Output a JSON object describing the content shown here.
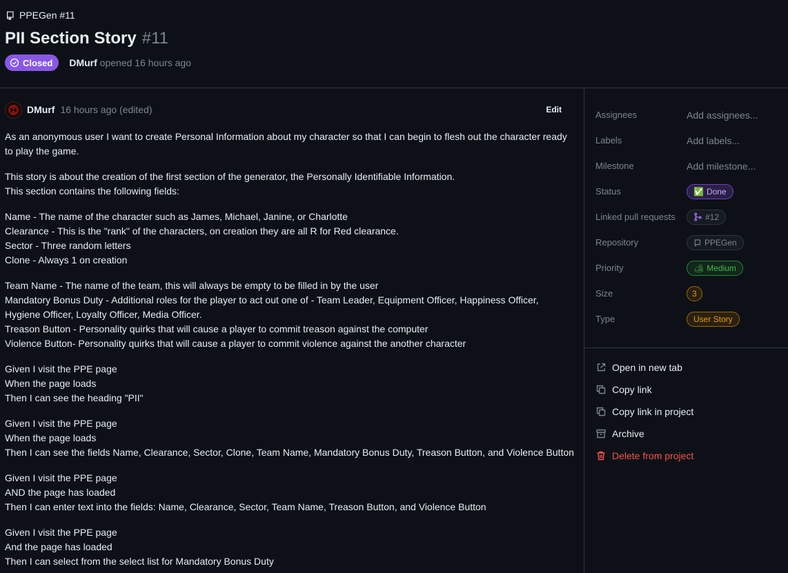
{
  "header": {
    "crumb": "PPEGen #11",
    "title": "PII Section Story",
    "number": "#11",
    "status": "Closed",
    "author": "DMurf",
    "opened_text": "opened 16 hours ago"
  },
  "comment": {
    "author": "DMurf",
    "time": "16 hours ago (edited)",
    "edit_label": "Edit",
    "paragraphs": [
      [
        "As an anonymous user I want to create Personal Information about my character so that I can begin to flesh out the character ready to play the game."
      ],
      [
        "This story is about the creation of the first section of the generator, the Personally Identifiable Information.",
        "This section contains the following fields:"
      ],
      [
        "Name - The name of the character such as James, Michael, Janine, or Charlotte",
        "Clearance - This is the \"rank\" of the characters, on creation they are all R for Red clearance.",
        "Sector - Three random letters",
        "Clone - Always 1 on creation"
      ],
      [
        "Team Name - The name of the team, this will always be empty to be filled in by the user",
        "Mandatory Bonus Duty - Additional roles for the player to act out one of - Team Leader, Equipment Officer, Happiness Officer, Hygiene Officer, Loyalty Officer, Media Officer.",
        "Treason Button - Personality quirks that will cause a player to commit treason against the computer",
        "Violence Button- Personality quirks that will cause a player to commit violence against the another character"
      ],
      [
        "Given I visit the PPE page",
        "When the page loads",
        "Then I can see the heading \"PII\""
      ],
      [
        "Given I visit the PPE page",
        "When the page loads",
        "Then I can see the fields Name, Clearance, Sector, Clone, Team Name, Mandatory Bonus Duty, Treason Button, and Violence Button"
      ],
      [
        "Given I visit the PPE page",
        "AND the page has loaded",
        "Then I can enter text into the fields: Name, Clearance, Sector, Team Name, Treason Button, and Violence Button"
      ],
      [
        "Given I visit the PPE page",
        "And the page has loaded",
        "Then I can select from the select list for Mandatory Bonus Duty"
      ]
    ]
  },
  "sidebar": {
    "assignees": {
      "label": "Assignees",
      "value": "Add assignees..."
    },
    "labels": {
      "label": "Labels",
      "value": "Add labels..."
    },
    "milestone": {
      "label": "Milestone",
      "value": "Add milestone..."
    },
    "status": {
      "label": "Status",
      "value": "Done",
      "emoji": "✅"
    },
    "linked_prs": {
      "label": "Linked pull requests",
      "value": "#12"
    },
    "repository": {
      "label": "Repository",
      "value": "PPEGen"
    },
    "priority": {
      "label": "Priority",
      "value": "Medium",
      "emoji": "🏕"
    },
    "size": {
      "label": "Size",
      "value": "3"
    },
    "type": {
      "label": "Type",
      "value": "User Story"
    }
  },
  "actions": {
    "open_new_tab": "Open in new tab",
    "copy_link": "Copy link",
    "copy_link_project": "Copy link in project",
    "archive": "Archive",
    "delete": "Delete from project"
  },
  "colors": {
    "background": "#0d1117",
    "closed_badge": "#8957e5",
    "danger": "#f85149",
    "muted": "#7d8590"
  }
}
